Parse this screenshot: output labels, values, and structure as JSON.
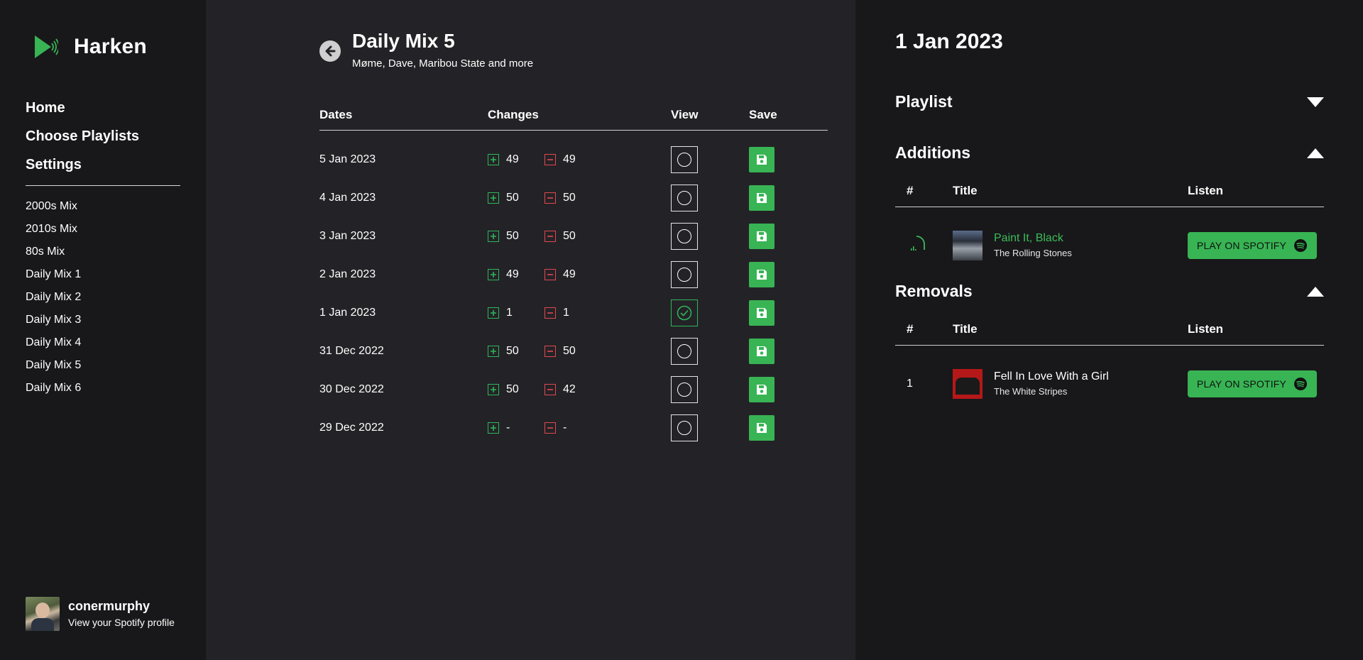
{
  "app": {
    "name": "Harken",
    "accent": "#38b454",
    "removal_color": "#e0474f"
  },
  "sidebar": {
    "nav": [
      {
        "label": "Home"
      },
      {
        "label": "Choose Playlists"
      },
      {
        "label": "Settings"
      }
    ],
    "playlists": [
      {
        "label": "2000s Mix"
      },
      {
        "label": "2010s Mix"
      },
      {
        "label": "80s Mix"
      },
      {
        "label": "Daily Mix 1"
      },
      {
        "label": "Daily Mix 2"
      },
      {
        "label": "Daily Mix 3"
      },
      {
        "label": "Daily Mix 4"
      },
      {
        "label": "Daily Mix 5"
      },
      {
        "label": "Daily Mix 6"
      }
    ],
    "profile": {
      "name": "conermurphy",
      "link": "View your Spotify profile"
    }
  },
  "main": {
    "title": "Daily Mix 5",
    "subtitle": "Møme, Dave, Maribou State and more",
    "columns": {
      "dates": "Dates",
      "changes": "Changes",
      "view": "View",
      "save": "Save"
    },
    "rows": [
      {
        "date": "5 Jan 2023",
        "added": "49",
        "removed": "49",
        "selected": false
      },
      {
        "date": "4 Jan 2023",
        "added": "50",
        "removed": "50",
        "selected": false
      },
      {
        "date": "3 Jan 2023",
        "added": "50",
        "removed": "50",
        "selected": false
      },
      {
        "date": "2 Jan 2023",
        "added": "49",
        "removed": "49",
        "selected": false
      },
      {
        "date": "1 Jan 2023",
        "added": "1",
        "removed": "1",
        "selected": true
      },
      {
        "date": "31 Dec 2022",
        "added": "50",
        "removed": "50",
        "selected": false
      },
      {
        "date": "30 Dec 2022",
        "added": "50",
        "removed": "42",
        "selected": false
      },
      {
        "date": "29 Dec 2022",
        "added": "-",
        "removed": "-",
        "selected": false
      }
    ]
  },
  "detail": {
    "date": "1 Jan 2023",
    "playlist_section": {
      "label": "Playlist"
    },
    "additions": {
      "label": "Additions",
      "columns": {
        "num": "#",
        "title": "Title",
        "listen": "Listen"
      },
      "tracks": [
        {
          "num": "",
          "title": "Paint It, Black",
          "artist": "The Rolling Stones",
          "button": "PLAY ON SPOTIFY"
        }
      ]
    },
    "removals": {
      "label": "Removals",
      "columns": {
        "num": "#",
        "title": "Title",
        "listen": "Listen"
      },
      "tracks": [
        {
          "num": "1",
          "title": "Fell In Love With a Girl",
          "artist": "The White Stripes",
          "button": "PLAY ON SPOTIFY"
        }
      ]
    }
  }
}
